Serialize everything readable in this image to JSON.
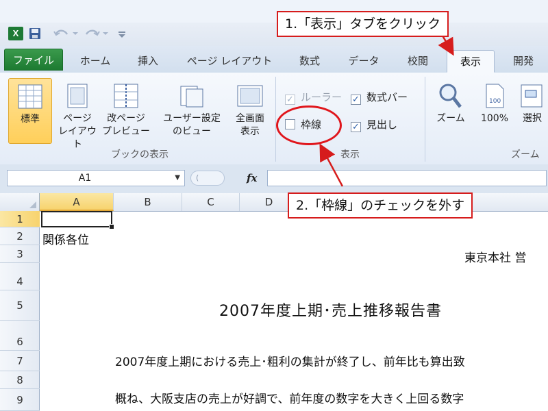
{
  "quick_access": {
    "app_icon_letter": "X",
    "icons": [
      "excel-icon",
      "save-icon",
      "undo-icon",
      "redo-icon",
      "customize-icon"
    ]
  },
  "ribbon_tabs": [
    {
      "label": "ファイル"
    },
    {
      "label": "ホーム"
    },
    {
      "label": "挿入"
    },
    {
      "label": "ページ レイアウト"
    },
    {
      "label": "数式"
    },
    {
      "label": "データ"
    },
    {
      "label": "校閲"
    },
    {
      "label": "表示"
    },
    {
      "label": "開発"
    }
  ],
  "active_tab": "表示",
  "groups": {
    "workbook_views": {
      "label": "ブックの表示",
      "buttons": [
        {
          "label": "標準",
          "selected": true
        },
        {
          "label": "ページ\nレイアウト"
        },
        {
          "label": "改ページ\nプレビュー"
        },
        {
          "label": "ユーザー設定\nのビュー"
        },
        {
          "label": "全画面\n表示"
        }
      ]
    },
    "show": {
      "label": "表示",
      "items": [
        {
          "label": "ルーラー",
          "checked": true,
          "disabled": true
        },
        {
          "label": "数式バー",
          "checked": true
        },
        {
          "label": "枠線",
          "checked": false
        },
        {
          "label": "見出し",
          "checked": true
        }
      ]
    },
    "zoom": {
      "label": "ズーム",
      "buttons": [
        {
          "label": "ズーム"
        },
        {
          "label": "100%"
        },
        {
          "label": "選択"
        }
      ]
    }
  },
  "formula_bar": {
    "name_box": "A1",
    "fx": "fx",
    "value": ""
  },
  "sheet": {
    "columns": [
      "A",
      "B",
      "C",
      "D"
    ],
    "active_column": "A",
    "rows": [
      "1",
      "2",
      "3",
      "4",
      "5",
      "6",
      "7",
      "8",
      "9"
    ],
    "active_row": "1",
    "cells": {
      "a2": "関係各位",
      "row3_right": "東京本社 営",
      "title": "2007年度上期･売上推移報告書",
      "row7": "2007年度上期における売上･粗利の集計が終了し、前年比も算出致",
      "row9": "概ね、大阪支店の売上が好調で、前年度の数字を大きく上回る数字"
    }
  },
  "callouts": {
    "step1": "1.「表示」タブをクリック",
    "step2": "2.「枠線」のチェックを外す",
    "color": "#d61c1c"
  },
  "colors": {
    "file_tab": "#1d7a31",
    "selected_button": "#ffcf5a",
    "ribbon_bg": "#f6f9fd"
  }
}
